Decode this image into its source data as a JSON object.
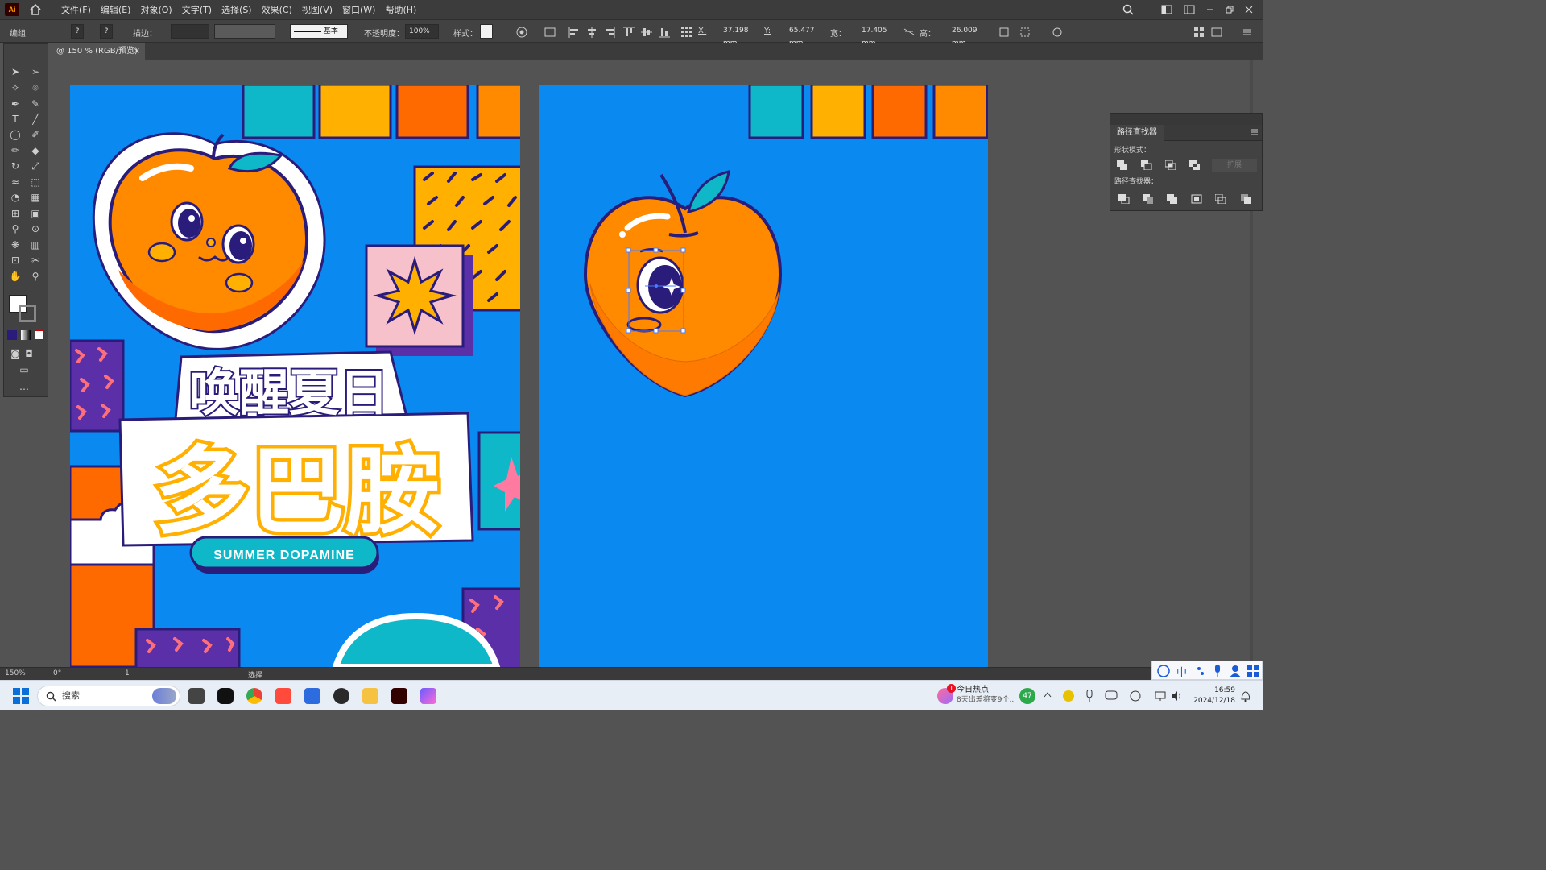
{
  "app": {
    "logo_text": "Ai",
    "menus": [
      "文件(F)",
      "编辑(E)",
      "对象(O)",
      "文字(T)",
      "选择(S)",
      "效果(C)",
      "视图(V)",
      "窗口(W)",
      "帮助(H)"
    ]
  },
  "control": {
    "selection_label": "编组",
    "stroke_label": "描边：",
    "stroke_profile": "基本",
    "opacity_label": "不透明度：",
    "opacity_value": "100%",
    "style_label": "样式：",
    "x_label": "X:",
    "x_value": "37.198 mm",
    "y_label": "Y:",
    "y_value": "65.477 mm",
    "w_label": "宽：",
    "w_value": "17.405 mm",
    "h_label": "高：",
    "h_value": "26.009 mm"
  },
  "document_tab": {
    "label": "@ 150 % (RGB/预览)",
    "close": "×"
  },
  "poster": {
    "title_line1": "唤醒夏日",
    "title_line2": "多巴胺",
    "subtitle": "SUMMER DOPAMINE"
  },
  "colors": {
    "canvas_blue": "#0a8af0",
    "teal": "#0fb8c8",
    "yellow": "#ffb000",
    "orange_dark": "#ff6a00",
    "orange": "#ff8a00",
    "navy": "#2a1c7a",
    "purple": "#5b2fa8",
    "pink": "#f7c1cb"
  },
  "pathfinder": {
    "tab": "路径查找器",
    "shape_modes_label": "形状模式：",
    "expand_label": "扩展",
    "pathfinders_label": "路径查找器："
  },
  "status": {
    "zoom": "150%",
    "rotation": "0°",
    "artboard": "1",
    "tool": "选择"
  },
  "taskbar": {
    "search_placeholder": "搜索",
    "news_title": "今日热点",
    "news_subtitle": "8天出差将变9个...",
    "news_badge": "1",
    "weather_badge": "47",
    "time": "16:59",
    "date": "2024/12/18"
  },
  "ime": {
    "lang": "中"
  }
}
